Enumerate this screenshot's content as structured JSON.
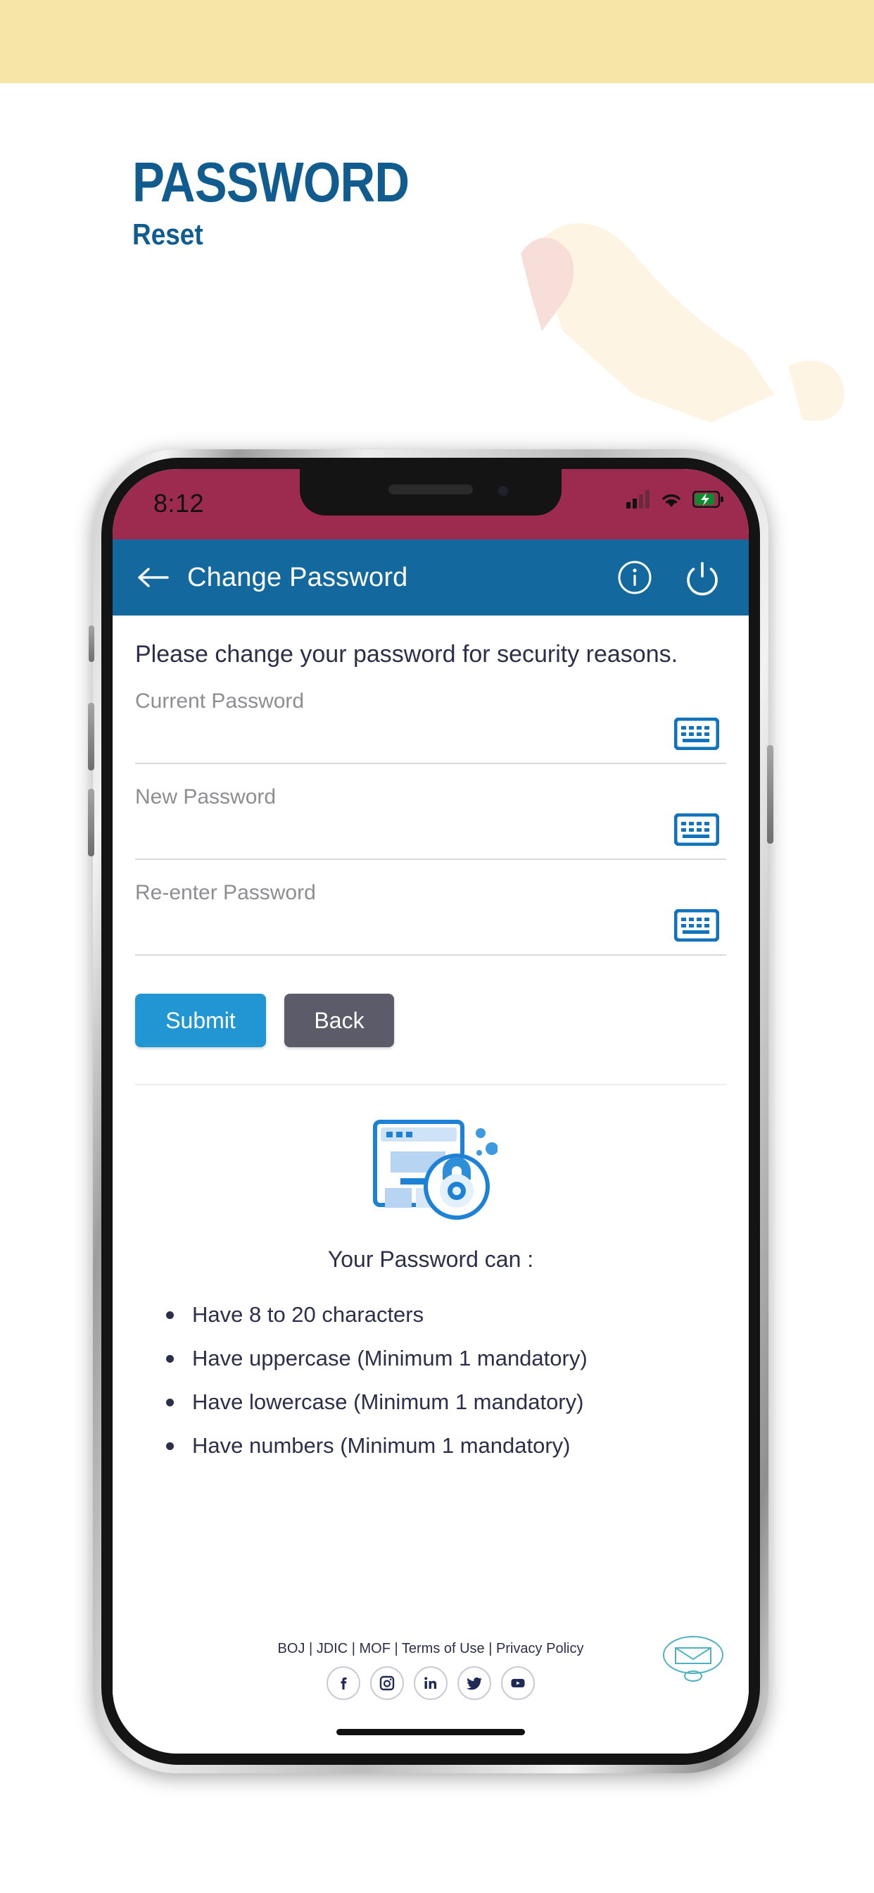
{
  "page": {
    "title_line1": "PASSWORD",
    "title_line2": "Reset",
    "brand_blue": "#115c8e",
    "band_color": "#f7e5a8"
  },
  "phone": {
    "status_bar": {
      "time": "8:12",
      "background": "#9d2b4f",
      "icons": [
        "signal-icon",
        "wifi-icon",
        "battery-charging-icon"
      ]
    },
    "header": {
      "title": "Change Password",
      "background": "#13699e",
      "back_icon": "arrow-left-icon",
      "actions": [
        "info-icon",
        "power-icon"
      ]
    },
    "body": {
      "instruction": "Please change your password for security reasons.",
      "fields": [
        {
          "label": "Current Password",
          "value": "",
          "placeholder": "",
          "icon": "keyboard-icon"
        },
        {
          "label": "New Password",
          "value": "",
          "placeholder": "",
          "icon": "keyboard-icon"
        },
        {
          "label": "Re-enter Password",
          "value": "",
          "placeholder": "",
          "icon": "keyboard-icon"
        }
      ],
      "buttons": {
        "submit_label": "Submit",
        "submit_color": "#2196d3",
        "back_label": "Back",
        "back_color": "#5b5b69"
      },
      "illustration": "browser-lock-icon",
      "rules_title": "Your Password can :",
      "rules": [
        "Have 8 to 20 characters",
        "Have uppercase (Minimum 1 mandatory)",
        "Have lowercase (Minimum 1 mandatory)",
        "Have numbers (Minimum 1 mandatory)"
      ]
    },
    "footer": {
      "links_text": "BOJ | JDIC | MOF | Terms of Use | Privacy Policy",
      "social": [
        "facebook-icon",
        "instagram-icon",
        "linkedin-icon",
        "twitter-icon",
        "youtube-icon"
      ],
      "mark": "envelope-icon"
    }
  }
}
